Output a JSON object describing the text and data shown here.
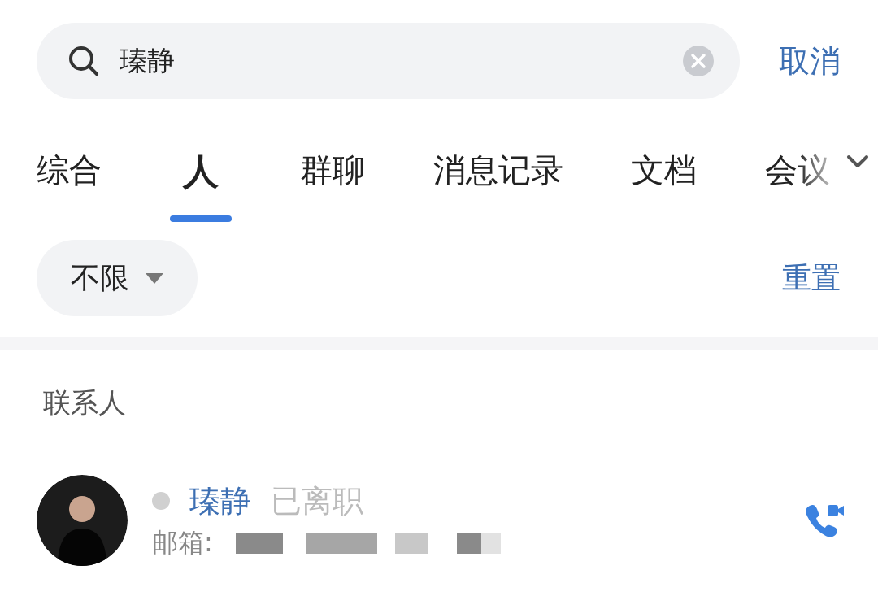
{
  "search": {
    "value": "瑧静",
    "cancel": "取消"
  },
  "tabs": [
    {
      "label": "综合",
      "selected": false
    },
    {
      "label": "人",
      "selected": true
    },
    {
      "label": "群聊",
      "selected": false
    },
    {
      "label": "消息记录",
      "selected": false
    },
    {
      "label": "文档",
      "selected": false
    },
    {
      "label": "会议",
      "selected": false
    }
  ],
  "filter": {
    "label": "不限",
    "reset": "重置"
  },
  "section": {
    "title": "联系人"
  },
  "contacts": [
    {
      "name": "瑧静",
      "status": "已离职",
      "online": false,
      "email_label": "邮箱:"
    }
  ]
}
